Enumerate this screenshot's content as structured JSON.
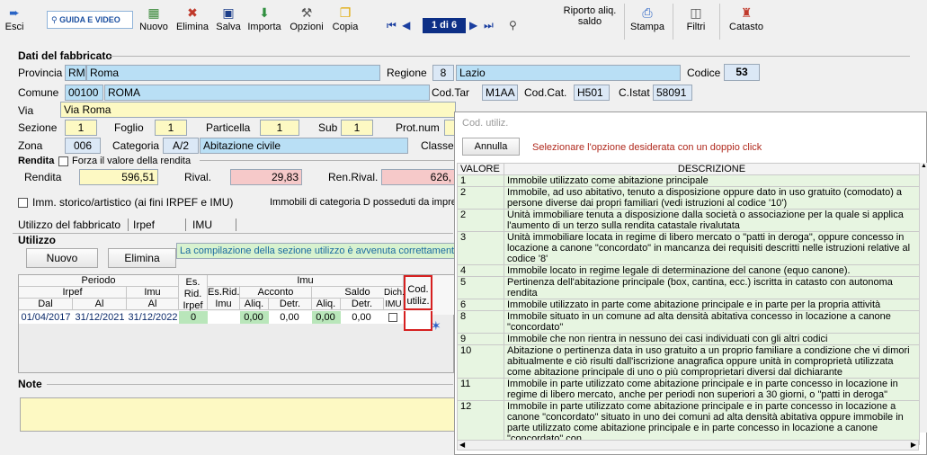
{
  "toolbar": {
    "exit": "Esci",
    "guide": "GUIDA E VIDEO",
    "new": "Nuovo",
    "delete": "Elimina",
    "save": "Salva",
    "import": "Importa",
    "options": "Opzioni",
    "copy": "Copia",
    "record_counter": "1 di 6",
    "riporto_line1": "Riporto aliq.",
    "riporto_line2": "saldo",
    "print": "Stampa",
    "filters": "Filtri",
    "catasto": "Catasto"
  },
  "fabbricato": {
    "title": "Dati del fabbricato",
    "provincia_label": "Provincia",
    "provincia_code": "RM",
    "provincia_name": "Roma",
    "regione_label": "Regione",
    "regione_code": "8",
    "regione_name": "Lazio",
    "codice_label": "Codice",
    "codice_value": "53",
    "comune_label": "Comune",
    "comune_cap": "00100",
    "comune_name": "ROMA",
    "codtar_label": "Cod.Tar",
    "codtar_value": "M1AA",
    "codcat_label": "Cod.Cat.",
    "codcat_value": "H501",
    "cistat_label": "C.Istat",
    "cistat_value": "58091",
    "via_label": "Via",
    "via_value": "Via Roma",
    "sezione_label": "Sezione",
    "sezione_value": "1",
    "foglio_label": "Foglio",
    "foglio_value": "1",
    "particella_label": "Particella",
    "particella_value": "1",
    "sub_label": "Sub",
    "sub_value": "1",
    "protnum_label": "Prot.num",
    "zona_label": "Zona",
    "zona_value": "006",
    "categoria_label": "Categoria",
    "categoria_code": "A/2",
    "categoria_desc": "Abitazione civile",
    "classe_label": "Classe",
    "rendita_title": "Rendita",
    "forza_label": "Forza il valore della rendita",
    "rendita_label": "Rendita",
    "rendita_value": "596,51",
    "rival_label": "Rival.",
    "rival_value": "29,83",
    "renrival_label": "Ren.Rival.",
    "renrival_value": "626,",
    "storico_label": "Imm. storico/artistico (ai fini IRPEF e IMU)",
    "categoria_d_label": "Immobili di categoria D posseduti da imprese"
  },
  "tabs": [
    "Utilizzo del fabbricato",
    "Irpef",
    "IMU"
  ],
  "utilizzo": {
    "title": "Utilizzo",
    "new_button": "Nuovo",
    "delete_button": "Elimina",
    "message": "La compilazione della sezione utilizzo è avvenuta correttamente",
    "headers": {
      "periodo": "Periodo",
      "irpef": "Irpef",
      "imu": "Imu",
      "dal": "Dal",
      "al": "Al",
      "es_rid": "Es.",
      "es_rid2": "Rid.",
      "es_rid3": "Irpef",
      "es_rid_imu": "Es.Rid.",
      "es_rid_imu2": "Imu",
      "imu_group": "Imu",
      "acconto": "Acconto",
      "saldo": "Saldo",
      "aliq": "Aliq.",
      "detr": "Detr.",
      "dich": "Dich.",
      "dich2": "IMU",
      "cod": "Cod.",
      "cod2": "utiliz."
    },
    "row": {
      "dal": "01/04/2017",
      "al_irpef": "31/12/2021",
      "al_imu": "31/12/2022",
      "es_rid_irpef": "0",
      "acc_aliq": "0,00",
      "acc_detr": "0,00",
      "saldo_aliq": "0,00",
      "saldo_detr": "0,00"
    }
  },
  "note": {
    "title": "Note"
  },
  "popup": {
    "title": "Cod. utiliz.",
    "cancel": "Annulla",
    "instruction": "Selezionare l'opzione desiderata con un doppio click",
    "col_valore": "VALORE",
    "col_descrizione": "DESCRIZIONE",
    "rows": [
      {
        "v": "1",
        "d": "Immobile utilizzato come abitazione principale"
      },
      {
        "v": "2",
        "d": "Immobile, ad uso abitativo, tenuto a disposizione oppure dato in uso gratuito (comodato) a persone diverse dai propri familiari (vedi istruzioni al codice '10')"
      },
      {
        "v": "2",
        "d": "Unità immobiliare tenuta a disposizione dalla società o associazione per la quale si applica l'aumento di un terzo sulla rendita catastale rivalutata"
      },
      {
        "v": "3",
        "d": "Unità immobiliare locata in regime di libero mercato o \"patti in deroga\", oppure concesso in locazione a canone \"concordato\" in mancanza dei requisiti descritti nelle istruzioni relative al codice '8'"
      },
      {
        "v": "4",
        "d": "Immobile locato in regime legale di determinazione del canone (equo canone)."
      },
      {
        "v": "5",
        "d": "Pertinenza dell'abitazione principale (box, cantina, ecc.) iscritta in catasto con autonoma rendita"
      },
      {
        "v": "6",
        "d": "Immobile utilizzato in parte come abitazione principale e in parte per la propria attività"
      },
      {
        "v": "8",
        "d": "Immobile situato in un comune ad alta densità abitativa concesso in locazione a canone \"concordato\""
      },
      {
        "v": "9",
        "d": "Immobile che non rientra in nessuno dei casi individuati con gli altri codici"
      },
      {
        "v": "10",
        "d": "Abitazione o pertinenza data in uso gratuito a un proprio familiare a condizione che vi dimori abitualmente e ciò risulti dall'iscrizione anagrafica oppure unità in comproprietà utilizzata come abitazione principale di uno o più comproprietari diversi dal dichiarante"
      },
      {
        "v": "11",
        "d": "Immobile in parte utilizzato come abitazione principale e in parte concesso in locazione in regime di libero mercato, anche per periodi non superiori a 30 giorni, o \"patti in deroga\""
      },
      {
        "v": "12",
        "d": "Immobile in parte utilizzato come abitazione principale e in parte concesso in locazione a canone \"concordato\" situato in uno dei comuni ad alta densità abitativa oppure immobile in parte utilizzato come abitazione principale e in parte concesso in locazione a canone \"concordato\" con"
      }
    ]
  }
}
